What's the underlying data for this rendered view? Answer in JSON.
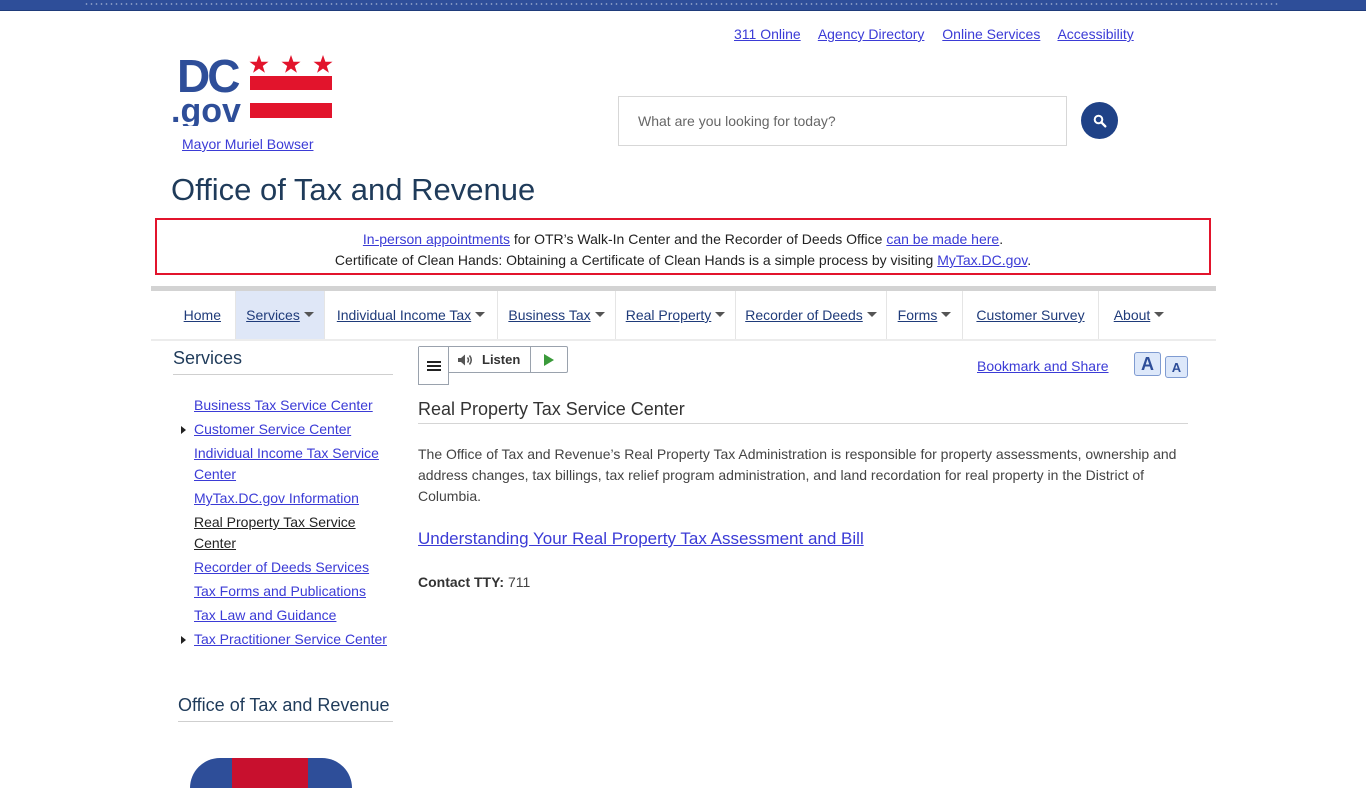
{
  "utility_nav": [
    "311 Online",
    "Agency Directory",
    "Online Services",
    "Accessibility"
  ],
  "logo": {
    "dc": "DC",
    "gov": ".gov",
    "brand_blue": "#2e4e99",
    "brand_red": "#e2142c"
  },
  "mayor_link": "Mayor Muriel Bowser",
  "search": {
    "placeholder": "What are you looking for today?",
    "button_icon": "search-icon"
  },
  "agency_title": "Office of Tax and Revenue",
  "alert": {
    "line1": {
      "link1": "In-person appointments",
      "text1": " for OTR’s Walk-In Center and the Recorder of Deeds Office ",
      "link2": "can be made here",
      "text2": "."
    },
    "line2": {
      "text1": "Certificate of Clean Hands: Obtaining a Certificate of Clean Hands is a simple process by visiting ",
      "link": "MyTax.DC.gov",
      "text2": "."
    }
  },
  "main_nav": [
    {
      "label": "Home"
    },
    {
      "label": "Services",
      "active": true
    },
    {
      "label": "Individual Income Tax"
    },
    {
      "label": "Business Tax"
    },
    {
      "label": "Real Property"
    },
    {
      "label": "Recorder of Deeds"
    },
    {
      "label": "Forms"
    },
    {
      "label": "Customer Survey"
    },
    {
      "label": "About"
    }
  ],
  "sidebar": {
    "heading": "Services",
    "items": [
      {
        "label": "Business Tax Service Center"
      },
      {
        "label": "Customer Service Center",
        "expandable": true
      },
      {
        "label": "Individual Income Tax Service Center"
      },
      {
        "label": "MyTax.DC.gov Information"
      },
      {
        "label": "Real Property Tax Service Center",
        "current": true
      },
      {
        "label": "Recorder of Deeds Services"
      },
      {
        "label": "Tax Forms and Publications"
      },
      {
        "label": "Tax Law and Guidance"
      },
      {
        "label": "Tax Practitioner Service Center",
        "expandable": true
      }
    ],
    "heading2": "Office of Tax and Revenue"
  },
  "listen": {
    "label": "Listen"
  },
  "bookmark": "Bookmark and Share",
  "font_size": {
    "increase": "A",
    "decrease": "A"
  },
  "content": {
    "title": "Real Property Tax Service Center",
    "intro": "The Office of Tax and Revenue’s Real Property Tax Administration is responsible for property assessments, ownership and address changes, tax billings, tax relief program administration, and land recordation for real property in the District of Columbia.",
    "link": "Understanding Your Real Property Tax Assessment and Bill",
    "contact_label": "Contact TTY:",
    "contact_value": " 711"
  }
}
